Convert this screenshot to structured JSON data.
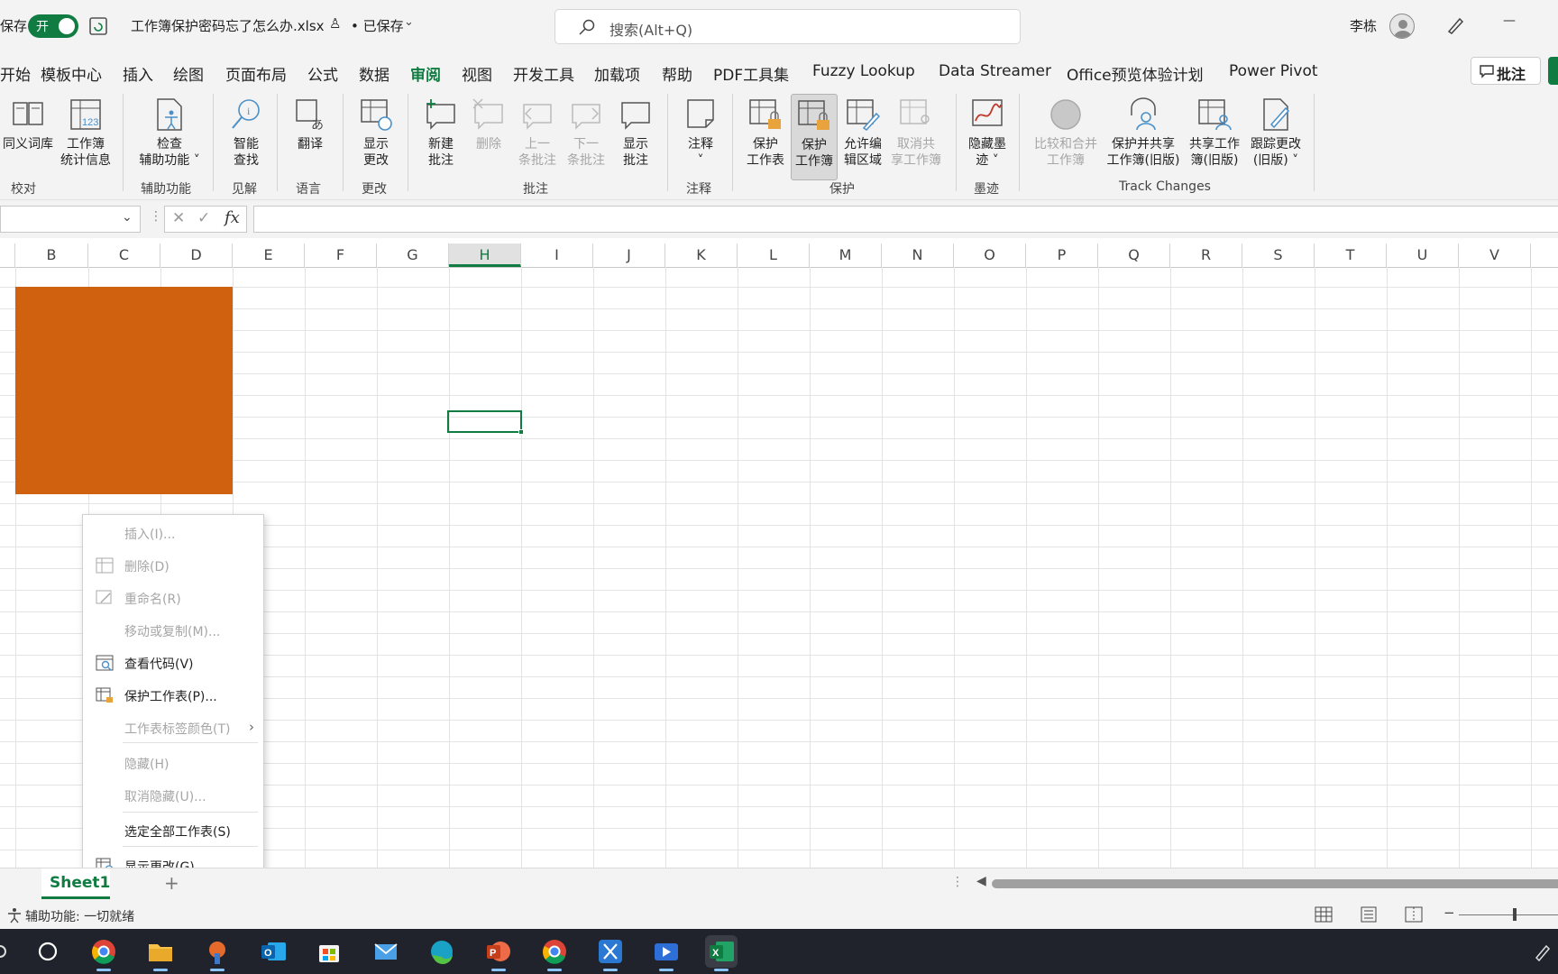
{
  "titlebar": {
    "autosave_label": "保存",
    "toggle_label": "开",
    "filename": "工作簿保护密码忘了怎么办.xlsx",
    "saved_status": "• 已保存",
    "search_placeholder": "搜索(Alt+Q)",
    "user_name": "李栋",
    "minimize_glyph": "—"
  },
  "menu_tabs": [
    "开始",
    "模板中心",
    "插入",
    "绘图",
    "页面布局",
    "公式",
    "数据",
    "审阅",
    "视图",
    "开发工具",
    "加载项",
    "帮助",
    "PDF工具集",
    "Fuzzy Lookup",
    "Data Streamer",
    "Office预览体验计划",
    "Power Pivot"
  ],
  "active_tab": "审阅",
  "comments_button": "批注",
  "ribbon": {
    "buttons": [
      {
        "label": "同义词库",
        "disabled": false
      },
      {
        "label": "工作簿\n统计信息",
        "disabled": false
      },
      {
        "label": "检查\n辅助功能 ˅",
        "disabled": false
      },
      {
        "label": "智能\n查找",
        "disabled": false
      },
      {
        "label": "翻译",
        "disabled": false
      },
      {
        "label": "显示\n更改",
        "disabled": false
      },
      {
        "label": "新建\n批注",
        "disabled": false
      },
      {
        "label": "删除",
        "disabled": true
      },
      {
        "label": "上一\n条批注",
        "disabled": true
      },
      {
        "label": "下一\n条批注",
        "disabled": true
      },
      {
        "label": "显示\n批注",
        "disabled": false
      },
      {
        "label": "注释\n˅",
        "disabled": false
      },
      {
        "label": "保护\n工作表",
        "disabled": false
      },
      {
        "label": "保护\n工作簿",
        "disabled": false,
        "pressed": true
      },
      {
        "label": "允许编\n辑区域",
        "disabled": false
      },
      {
        "label": "取消共\n享工作簿",
        "disabled": true
      },
      {
        "label": "隐藏墨\n迹 ˅",
        "disabled": false
      },
      {
        "label": "比较和合并\n工作簿",
        "disabled": true
      },
      {
        "label": "保护并共享\n工作簿(旧版)",
        "disabled": false
      },
      {
        "label": "共享工作\n簿(旧版)",
        "disabled": false
      },
      {
        "label": "跟踪更改\n(旧版) ˅",
        "disabled": false
      }
    ],
    "groups": [
      "校对",
      "辅助功能",
      "见解",
      "语言",
      "更改",
      "批注",
      "注释",
      "保护",
      "墨迹",
      "Track Changes"
    ]
  },
  "formula_bar": {
    "fx": "fx",
    "cancel": "✕",
    "confirm": "✓",
    "value": ""
  },
  "columns": [
    "B",
    "C",
    "D",
    "E",
    "F",
    "G",
    "H",
    "I",
    "J",
    "K",
    "L",
    "M",
    "N",
    "O",
    "P",
    "Q",
    "R",
    "S",
    "T",
    "U",
    "V"
  ],
  "selected_column": "H",
  "context_menu": [
    {
      "label": "插入(I)...",
      "disabled": true,
      "icon": ""
    },
    {
      "label": "删除(D)",
      "disabled": true,
      "icon": "delete-sheet-icon"
    },
    {
      "label": "重命名(R)",
      "disabled": true,
      "icon": "rename-icon"
    },
    {
      "label": "移动或复制(M)...",
      "disabled": true,
      "icon": ""
    },
    {
      "label": "查看代码(V)",
      "disabled": false,
      "icon": "view-code-icon"
    },
    {
      "label": "保护工作表(P)...",
      "disabled": false,
      "icon": "protect-sheet-icon"
    },
    {
      "label": "工作表标签颜色(T)",
      "disabled": true,
      "icon": "",
      "submenu": true
    },
    {
      "label": "隐藏(H)",
      "disabled": true,
      "icon": ""
    },
    {
      "label": "取消隐藏(U)...",
      "disabled": true,
      "icon": ""
    },
    {
      "label": "选定全部工作表(S)",
      "disabled": false,
      "icon": ""
    },
    {
      "label": "显示更改(G)",
      "disabled": false,
      "icon": "show-changes-icon"
    }
  ],
  "sheet_tab": "Sheet1",
  "add_sheet": "+",
  "status": {
    "accessibility": "辅助功能: 一切就绪"
  },
  "colors": {
    "accent": "#107c41",
    "shape_fill": "#d0610f"
  },
  "taskbar_icons": [
    "cortana-icon",
    "chrome-icon",
    "file-explorer-icon",
    "app-icon",
    "outlook-icon",
    "store-icon",
    "mail-icon",
    "edge-icon",
    "powerpoint-icon",
    "chrome-icon",
    "snipping-tool-icon",
    "video-icon",
    "excel-icon"
  ]
}
